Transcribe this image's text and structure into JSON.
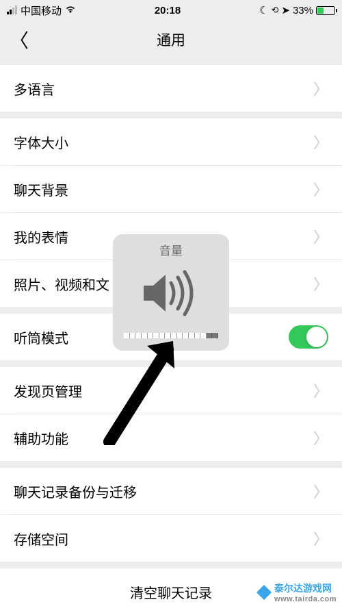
{
  "status": {
    "carrier": "中国移动",
    "time": "20:18",
    "battery_pct": "33%"
  },
  "nav": {
    "title": "通用"
  },
  "items": {
    "language": "多语言",
    "font_size": "字体大小",
    "chat_bg": "聊天背景",
    "stickers": "我的表情",
    "media": "照片、视频和文",
    "earpiece": "听筒模式",
    "discover": "发现页管理",
    "accessibility": "辅助功能",
    "backup": "聊天记录备份与迁移",
    "storage": "存储空间",
    "clear": "清空聊天记录"
  },
  "hud": {
    "title": "音量",
    "level_of_16": 14
  },
  "watermark": {
    "brand": "泰尔达游戏网",
    "url": "www.tairda.com"
  }
}
